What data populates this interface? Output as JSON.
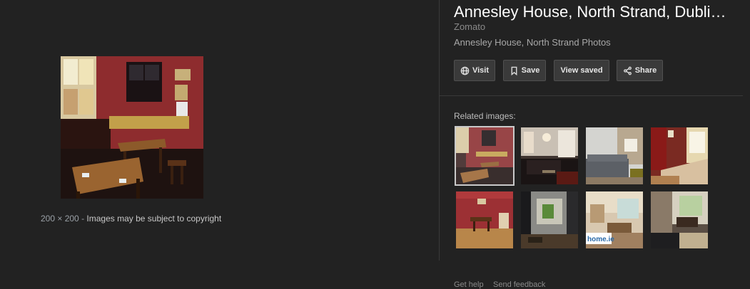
{
  "preview": {
    "dimensions": "200 × 200",
    "separator": "-",
    "copyright": "Images may be subject to copyright"
  },
  "panel": {
    "title": "Annesley House, North Strand, Dubli…",
    "source": "Zomato",
    "subtitle": "Annesley House, North Strand Photos",
    "buttons": {
      "visit": "Visit",
      "save": "Save",
      "view_saved": "View saved",
      "share": "Share"
    },
    "related_label": "Related images:"
  },
  "footer": {
    "help": "Get help",
    "feedback": "Send feedback"
  },
  "icons": {
    "visit": "globe-icon",
    "save": "bookmark-icon",
    "share": "share-icon"
  },
  "colors": {
    "background": "#222222",
    "button_bg": "#3a3a3a",
    "divider": "#3a3a3a"
  }
}
